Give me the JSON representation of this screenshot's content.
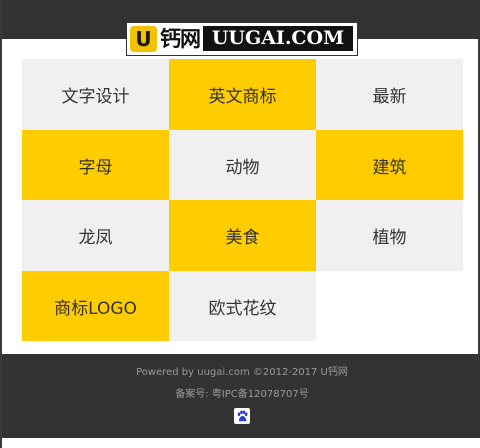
{
  "header": {
    "logo_badge": "U",
    "logo_cn": "钙网",
    "logo_en": "UUGAI.COM"
  },
  "grid": {
    "cells": [
      {
        "label": "文字设计",
        "color": "gray"
      },
      {
        "label": "英文商标",
        "color": "yellow"
      },
      {
        "label": "最新",
        "color": "gray"
      },
      {
        "label": "字母",
        "color": "yellow"
      },
      {
        "label": "动物",
        "color": "gray"
      },
      {
        "label": "建筑",
        "color": "yellow"
      },
      {
        "label": "龙凤",
        "color": "gray"
      },
      {
        "label": "美食",
        "color": "yellow"
      },
      {
        "label": "植物",
        "color": "gray"
      },
      {
        "label": "商标LOGO",
        "color": "yellow"
      },
      {
        "label": "欧式花纹",
        "color": "gray"
      }
    ]
  },
  "footer": {
    "powered_by": "Powered by uugai.com ©2012-2017 U钙网",
    "icp": "备案号: 粤IPC备12078707号",
    "stats_icon": "baidu-paw-icon"
  },
  "colors": {
    "header_bg": "#333333",
    "accent_yellow": "#ffcc00",
    "tile_gray": "#f0f0f0",
    "footer_text": "#9a9a9a"
  }
}
